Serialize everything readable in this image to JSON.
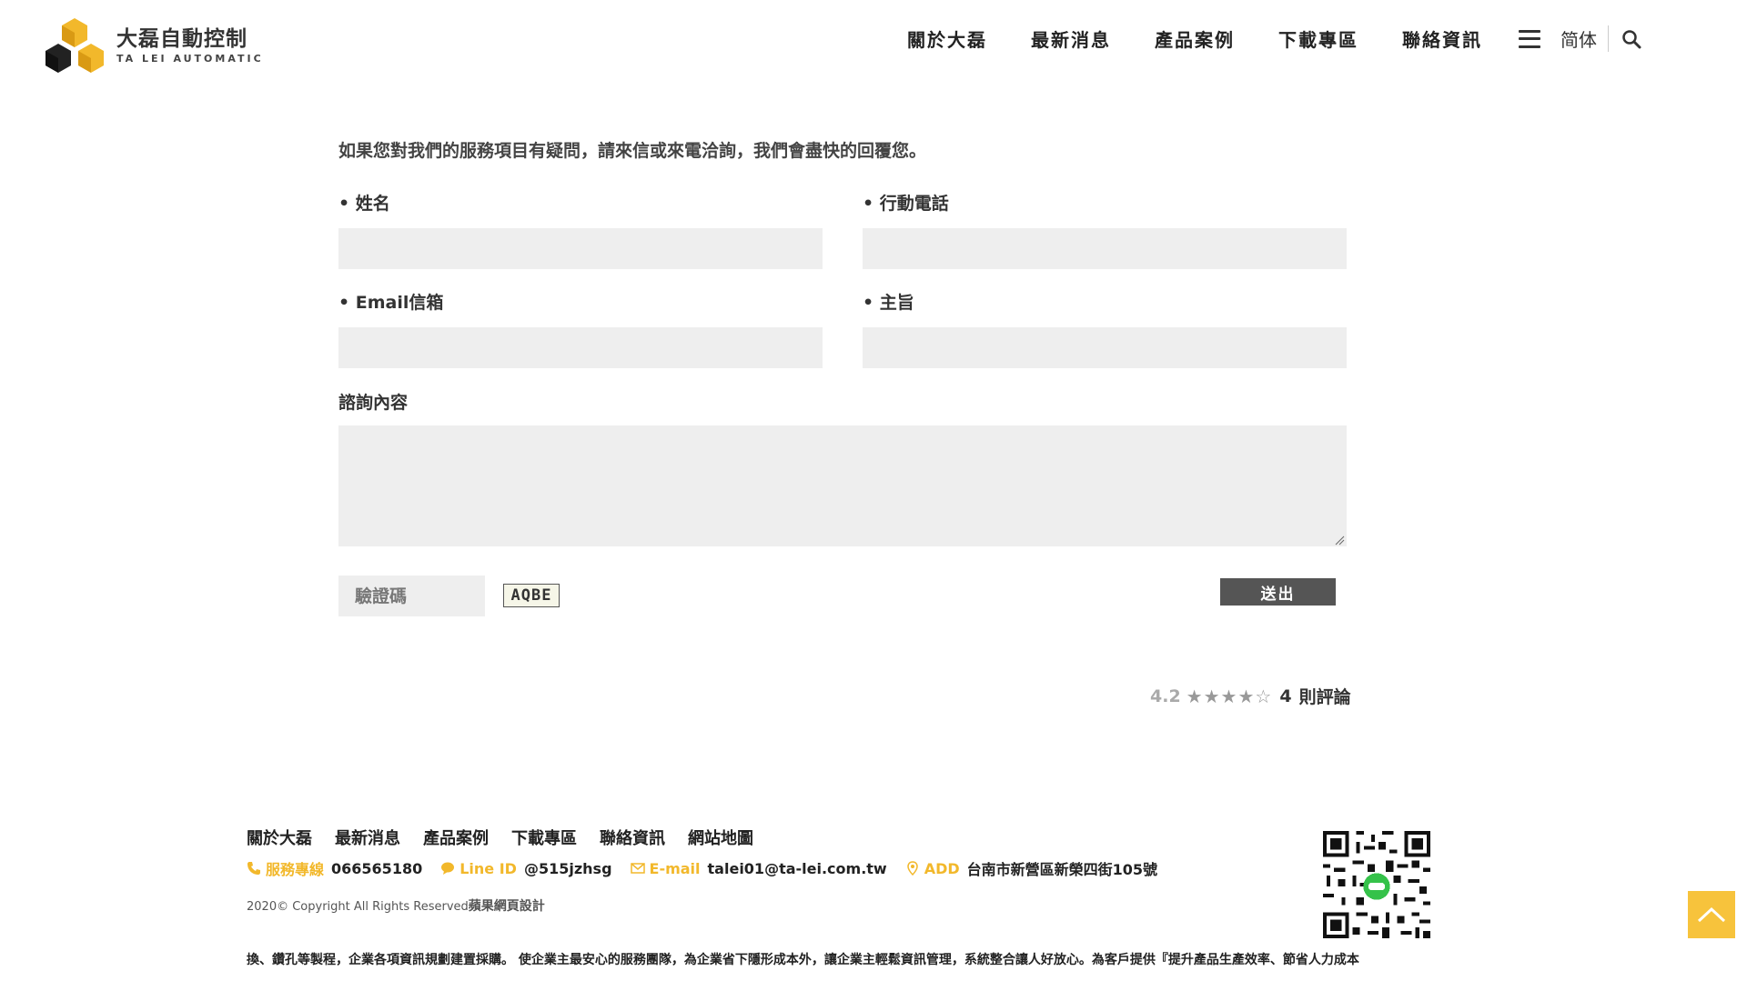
{
  "header": {
    "logo_cn": "大磊自動控制",
    "logo_en": "TA LEI AUTOMATIC",
    "nav": [
      "關於大磊",
      "最新消息",
      "產品案例",
      "下載專區",
      "聯絡資訊"
    ],
    "lang": "简体"
  },
  "form": {
    "intro": "如果您對我們的服務項目有疑問，請來信或來電洽詢，我們會盡快的回覆您。",
    "name_label": "• 姓名",
    "phone_label": "• 行動電話",
    "email_label": "• Email信箱",
    "subject_label": "• 主旨",
    "content_label": "諮詢內容",
    "captcha_placeholder": "驗證碼",
    "captcha_code": "AQBE",
    "submit_label": "送出"
  },
  "rating": {
    "score": "4.2",
    "stars": 4.2,
    "count": "4",
    "unit": "則評論"
  },
  "footer": {
    "nav": [
      "關於大磊",
      "最新消息",
      "產品案例",
      "下載專區",
      "聯絡資訊",
      "網站地圖"
    ],
    "phone_label": "服務專線",
    "phone": "066565180",
    "line_label": "Line ID",
    "line": "@515jzhsg",
    "email_label": "E-mail",
    "email": "talei01@ta-lei.com.tw",
    "addr_label": "ADD",
    "addr": "台南市新營區新榮四街105號",
    "copyright": "2020© Copyright All Rights Reserved",
    "designer": "蘋果網頁設計",
    "marquee": "換、鑽孔等製程，企業各項資訊規劃建置採購。 使企業主最安心的服務團隊，為企業省下隱形成本外，讓企業主輕鬆資訊管理，系統整合讓人好放心。為客戶提供『提升產品生產效率、節省人力成本"
  },
  "colors": {
    "accent": "#f2b82b",
    "field_bg": "#eeeeee",
    "submit_bg": "#555555",
    "totop_bg": "#f7c33c"
  }
}
